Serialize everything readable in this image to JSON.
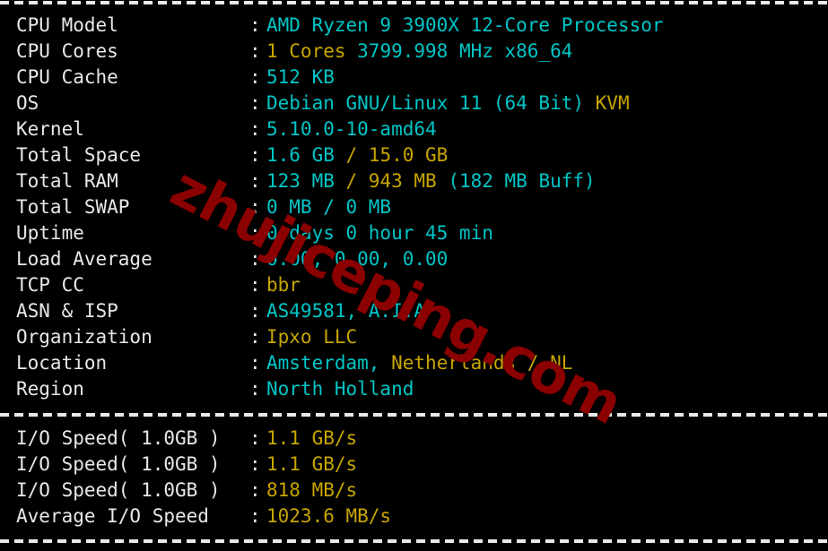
{
  "terminal": {
    "background_color": "#000000",
    "colors": {
      "label": "#e8e8e8",
      "cyan": "#00c5c7",
      "yellow": "#c7a500",
      "watermark": "#8b0000"
    },
    "separator_char": "-"
  },
  "watermark": {
    "text": "zhujiceping.com"
  },
  "system_info": {
    "rows": [
      {
        "label": "CPU Model",
        "colon": ":",
        "segments": [
          {
            "text": "AMD Ryzen 9 3900X 12-Core Processor",
            "color": "cyan"
          }
        ]
      },
      {
        "label": "CPU Cores",
        "colon": ":",
        "segments": [
          {
            "text": "1 Cores ",
            "color": "yellow"
          },
          {
            "text": "3799.998 MHz x86_64",
            "color": "cyan"
          }
        ]
      },
      {
        "label": "CPU Cache",
        "colon": ":",
        "segments": [
          {
            "text": "512 KB",
            "color": "cyan"
          }
        ]
      },
      {
        "label": "OS",
        "colon": ":",
        "segments": [
          {
            "text": "Debian GNU/Linux 11 (64 Bit) ",
            "color": "cyan"
          },
          {
            "text": "KVM",
            "color": "yellow"
          }
        ]
      },
      {
        "label": "Kernel",
        "colon": ":",
        "segments": [
          {
            "text": "5.10.0-10-amd64",
            "color": "cyan"
          }
        ]
      },
      {
        "label": "Total Space",
        "colon": ":",
        "segments": [
          {
            "text": "1.6 GB ",
            "color": "cyan"
          },
          {
            "text": "/ 15.0 GB",
            "color": "yellow"
          }
        ]
      },
      {
        "label": "Total RAM",
        "colon": ":",
        "segments": [
          {
            "text": "123 MB ",
            "color": "cyan"
          },
          {
            "text": "/ 943 MB ",
            "color": "yellow"
          },
          {
            "text": "(182 MB Buff)",
            "color": "cyan"
          }
        ]
      },
      {
        "label": "Total SWAP",
        "colon": ":",
        "segments": [
          {
            "text": "0 MB / 0 MB",
            "color": "cyan"
          }
        ]
      },
      {
        "label": "Uptime",
        "colon": ":",
        "segments": [
          {
            "text": "0 days 0 hour 45 min",
            "color": "cyan"
          }
        ]
      },
      {
        "label": "Load Average",
        "colon": ":",
        "segments": [
          {
            "text": "0.00, 0.00, 0.00",
            "color": "cyan"
          }
        ]
      },
      {
        "label": "TCP CC",
        "colon": ":",
        "segments": [
          {
            "text": "bbr",
            "color": "yellow"
          }
        ]
      },
      {
        "label": "ASN & ISP",
        "colon": ":",
        "segments": [
          {
            "text": "AS49581, A.I.A",
            "color": "cyan"
          }
        ]
      },
      {
        "label": "Organization",
        "colon": ":",
        "segments": [
          {
            "text": "Ipxo LLC",
            "color": "yellow"
          }
        ]
      },
      {
        "label": "Location",
        "colon": ":",
        "segments": [
          {
            "text": "Amsterdam, ",
            "color": "cyan"
          },
          {
            "text": "Netherlands / NL",
            "color": "yellow"
          }
        ]
      },
      {
        "label": "Region",
        "colon": ":",
        "segments": [
          {
            "text": "North Holland",
            "color": "cyan"
          }
        ]
      }
    ]
  },
  "io_results": {
    "rows": [
      {
        "label": "I/O Speed( 1.0GB )",
        "colon": ":",
        "segments": [
          {
            "text": "1.1 GB/s",
            "color": "yellow"
          }
        ]
      },
      {
        "label": "I/O Speed( 1.0GB )",
        "colon": ":",
        "segments": [
          {
            "text": "1.1 GB/s",
            "color": "yellow"
          }
        ]
      },
      {
        "label": "I/O Speed( 1.0GB )",
        "colon": ":",
        "segments": [
          {
            "text": "818 MB/s",
            "color": "yellow"
          }
        ]
      },
      {
        "label": "Average I/O Speed",
        "colon": ":",
        "segments": [
          {
            "text": "1023.6 MB/s",
            "color": "yellow"
          }
        ]
      }
    ]
  }
}
